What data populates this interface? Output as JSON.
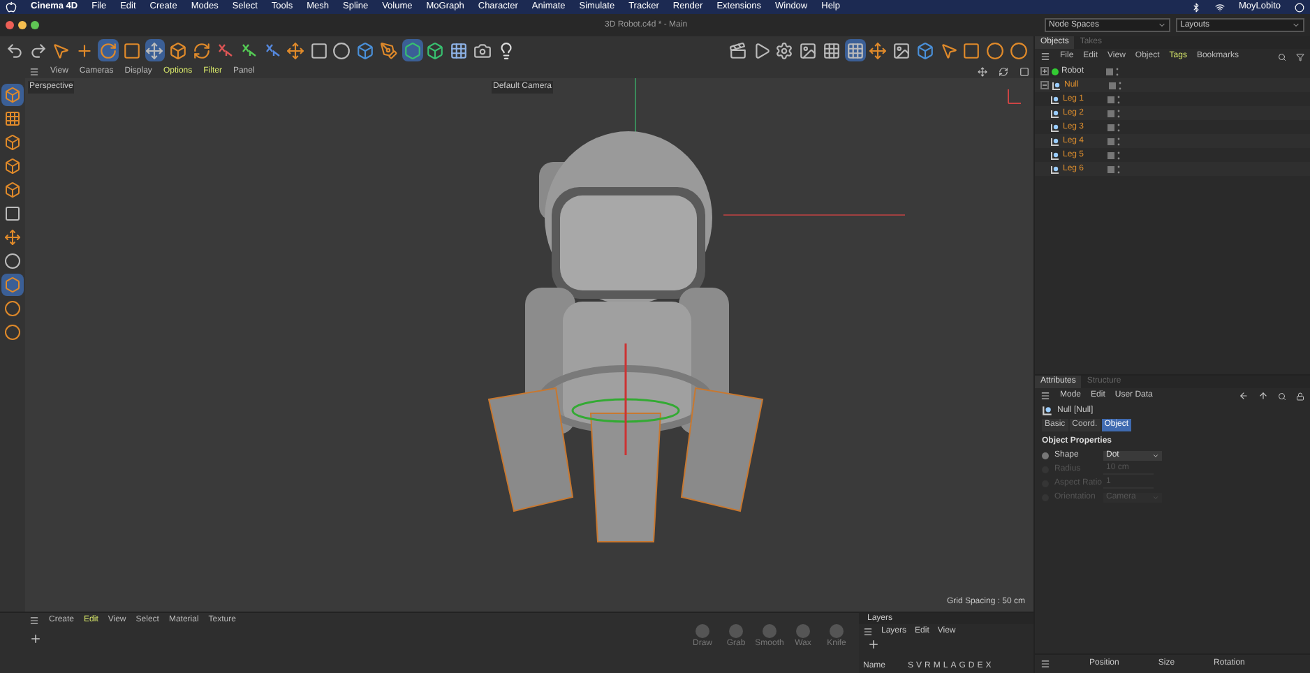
{
  "menubar": {
    "app": "Cinema 4D",
    "items": [
      "File",
      "Edit",
      "Create",
      "Modes",
      "Select",
      "Tools",
      "Mesh",
      "Spline",
      "Volume",
      "MoGraph",
      "Character",
      "Animate",
      "Simulate",
      "Tracker",
      "Render",
      "Extensions",
      "Window",
      "Help"
    ],
    "user": "MoyLobito"
  },
  "window": {
    "title": "3D Robot.c4d * - Main"
  },
  "dropdowns": {
    "node_spaces": "Node Spaces",
    "layouts": "Layouts"
  },
  "toolbar": [
    {
      "kind": "undo",
      "selected": false
    },
    {
      "kind": "redo",
      "selected": false
    },
    {
      "kind": "select",
      "selected": false
    },
    {
      "kind": "move",
      "selected": false
    },
    {
      "kind": "rotate",
      "selected": true
    },
    {
      "kind": "scale",
      "selected": false
    },
    {
      "kind": "transform",
      "selected": true
    },
    {
      "kind": "object",
      "selected": false
    },
    {
      "kind": "recent",
      "selected": false
    },
    {
      "kind": "axis-x",
      "selected": false
    },
    {
      "kind": "axis-y",
      "selected": false
    },
    {
      "kind": "axis-z",
      "selected": false
    },
    {
      "kind": "coords",
      "selected": false
    },
    {
      "kind": "floor",
      "selected": false
    },
    {
      "kind": "spline",
      "selected": false
    },
    {
      "kind": "cube",
      "selected": false
    },
    {
      "kind": "pen",
      "selected": false
    },
    {
      "kind": "subdivision",
      "selected": true
    },
    {
      "kind": "extrude",
      "selected": false
    },
    {
      "kind": "plane",
      "selected": false
    },
    {
      "kind": "camera",
      "selected": false
    },
    {
      "kind": "light",
      "selected": false
    },
    {
      "kind": "clapper",
      "selected": false
    },
    {
      "kind": "render",
      "selected": false
    },
    {
      "kind": "settings",
      "selected": false
    },
    {
      "kind": "picture",
      "selected": false
    },
    {
      "kind": "grid",
      "selected": false
    },
    {
      "kind": "grid",
      "selected": true
    },
    {
      "kind": "coords",
      "selected": false
    },
    {
      "kind": "picture",
      "selected": false
    },
    {
      "kind": "cube",
      "selected": false
    },
    {
      "kind": "select",
      "selected": false
    },
    {
      "kind": "box-select",
      "selected": false
    },
    {
      "kind": "lasso",
      "selected": false
    },
    {
      "kind": "lasso",
      "selected": false
    }
  ],
  "viewport_menu": [
    {
      "label": "View",
      "active": false
    },
    {
      "label": "Cameras",
      "active": false
    },
    {
      "label": "Display",
      "active": false
    },
    {
      "label": "Options",
      "active": true
    },
    {
      "label": "Filter",
      "active": true
    },
    {
      "label": "Panel",
      "active": false
    }
  ],
  "left_tools": [
    {
      "kind": "model",
      "selected": true
    },
    {
      "kind": "texture",
      "selected": false
    },
    {
      "kind": "points",
      "selected": false
    },
    {
      "kind": "edges",
      "selected": false
    },
    {
      "kind": "polygons",
      "selected": false
    },
    {
      "kind": "uv",
      "selected": false
    },
    {
      "kind": "axis",
      "selected": false
    },
    {
      "kind": "enable",
      "selected": false
    },
    {
      "kind": "snap",
      "selected": true
    },
    {
      "kind": "sculpt",
      "selected": false
    },
    {
      "kind": "coin",
      "selected": false
    }
  ],
  "viewport": {
    "label": "Perspective",
    "camera": "Default Camera",
    "grid_spacing": "Grid Spacing : 50 cm"
  },
  "objects_panel": {
    "tabs": [
      {
        "label": "Objects",
        "selected": true
      },
      {
        "label": "Takes",
        "selected": false
      }
    ],
    "menu": [
      {
        "label": "File",
        "active": false
      },
      {
        "label": "Edit",
        "active": false
      },
      {
        "label": "View",
        "active": false
      },
      {
        "label": "Object",
        "active": false
      },
      {
        "label": "Tags",
        "active": true
      },
      {
        "label": "Bookmarks",
        "active": false
      }
    ],
    "tree": [
      {
        "name": "Robot",
        "kind": "robot",
        "selected": false,
        "expanded": false
      },
      {
        "name": "Null",
        "kind": "null",
        "selected": true,
        "expanded": true,
        "children": [
          {
            "name": "Leg 1",
            "kind": "null",
            "selected": true
          },
          {
            "name": "Leg 2",
            "kind": "null",
            "selected": true
          },
          {
            "name": "Leg 3",
            "kind": "null",
            "selected": true
          },
          {
            "name": "Leg 4",
            "kind": "null",
            "selected": true
          },
          {
            "name": "Leg 5",
            "kind": "null",
            "selected": true
          },
          {
            "name": "Leg 6",
            "kind": "null",
            "selected": true
          }
        ]
      }
    ]
  },
  "attributes": {
    "tabs": [
      {
        "label": "Attributes",
        "selected": true
      },
      {
        "label": "Structure",
        "selected": false
      }
    ],
    "menu": [
      "Mode",
      "Edit",
      "User Data"
    ],
    "object": "Null [Null]",
    "subtabs": [
      {
        "label": "Basic",
        "selected": false
      },
      {
        "label": "Coord.",
        "selected": false
      },
      {
        "label": "Object",
        "selected": true
      }
    ],
    "section": "Object Properties",
    "props": [
      {
        "label": "Shape",
        "value": "Dot",
        "kind": "dropdown",
        "disabled": false
      },
      {
        "label": "Radius",
        "value": "10 cm",
        "kind": "number",
        "disabled": true
      },
      {
        "label": "Aspect Ratio",
        "value": "1",
        "kind": "number",
        "disabled": true
      },
      {
        "label": "Orientation",
        "value": "Camera",
        "kind": "dropdown",
        "disabled": true
      }
    ]
  },
  "material_menu": [
    {
      "label": "Create",
      "active": false
    },
    {
      "label": "Edit",
      "active": true
    },
    {
      "label": "View",
      "active": false
    },
    {
      "label": "Select",
      "active": false
    },
    {
      "label": "Material",
      "active": false
    },
    {
      "label": "Texture",
      "active": false
    }
  ],
  "brushes": [
    "Draw",
    "Grab",
    "Smooth",
    "Wax",
    "Knife"
  ],
  "layers": {
    "title": "Layers",
    "menu": [
      "Layers",
      "Edit",
      "View"
    ],
    "column": "Name",
    "flags": [
      "S",
      "V",
      "R",
      "M",
      "L",
      "A",
      "G",
      "D",
      "E",
      "X"
    ]
  },
  "coordinates": [
    "Position",
    "Size",
    "Rotation"
  ]
}
